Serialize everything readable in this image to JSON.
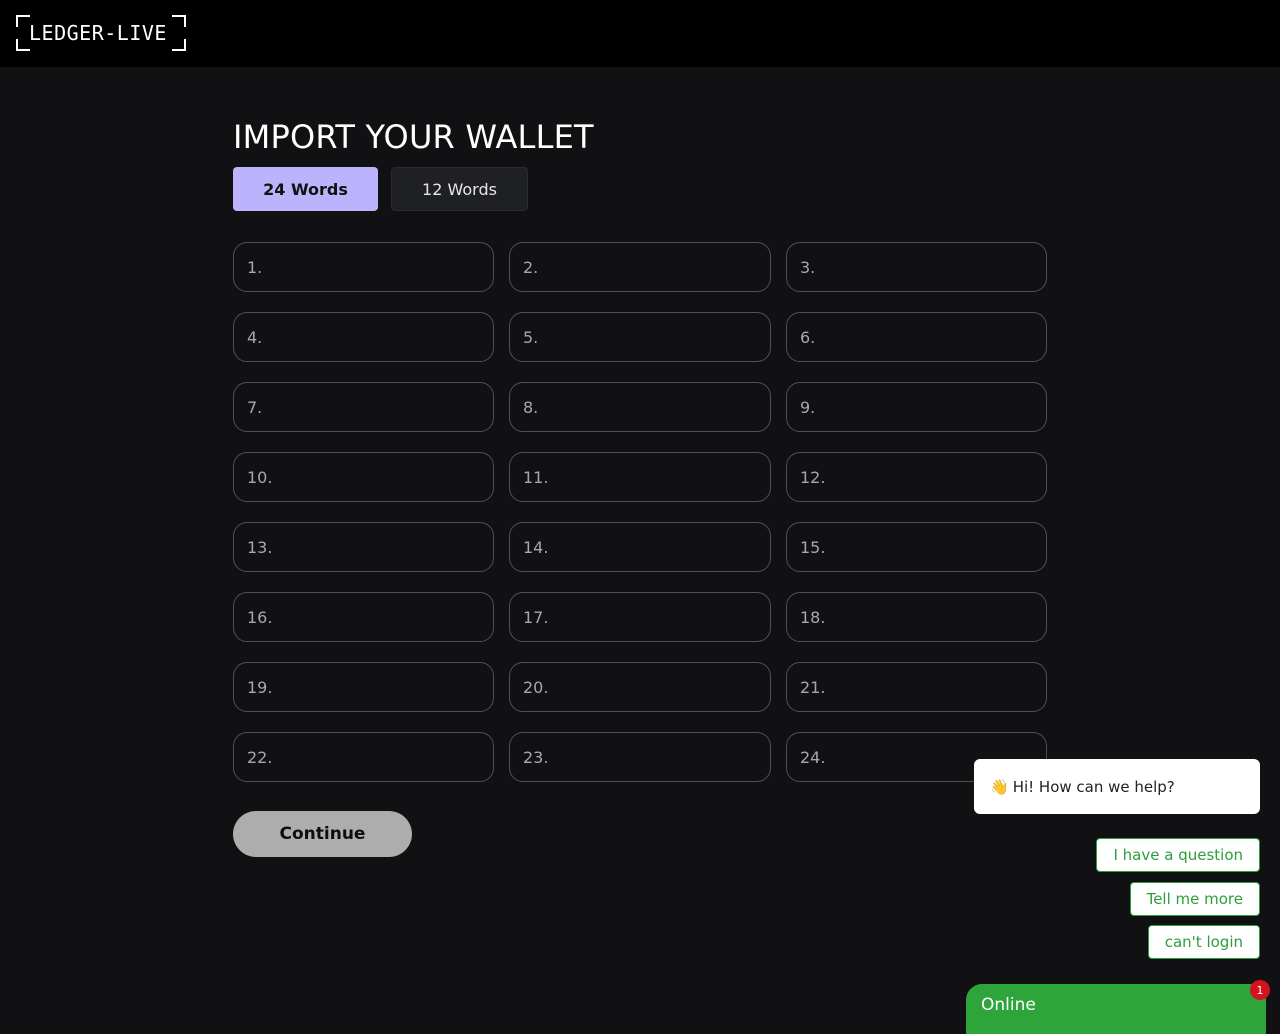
{
  "header": {
    "logo_text": "LEDGER-LIVE"
  },
  "main": {
    "title": "IMPORT YOUR WALLET",
    "tabs": [
      {
        "label": "24 Words",
        "active": true
      },
      {
        "label": "12 Words",
        "active": false
      }
    ],
    "word_fields": [
      {
        "placeholder": "1.",
        "value": ""
      },
      {
        "placeholder": "2.",
        "value": ""
      },
      {
        "placeholder": "3.",
        "value": ""
      },
      {
        "placeholder": "4.",
        "value": ""
      },
      {
        "placeholder": "5.",
        "value": ""
      },
      {
        "placeholder": "6.",
        "value": ""
      },
      {
        "placeholder": "7.",
        "value": ""
      },
      {
        "placeholder": "8.",
        "value": ""
      },
      {
        "placeholder": "9.",
        "value": ""
      },
      {
        "placeholder": "10.",
        "value": ""
      },
      {
        "placeholder": "11.",
        "value": ""
      },
      {
        "placeholder": "12.",
        "value": ""
      },
      {
        "placeholder": "13.",
        "value": ""
      },
      {
        "placeholder": "14.",
        "value": ""
      },
      {
        "placeholder": "15.",
        "value": ""
      },
      {
        "placeholder": "16.",
        "value": ""
      },
      {
        "placeholder": "17.",
        "value": ""
      },
      {
        "placeholder": "18.",
        "value": ""
      },
      {
        "placeholder": "19.",
        "value": ""
      },
      {
        "placeholder": "20.",
        "value": ""
      },
      {
        "placeholder": "21.",
        "value": ""
      },
      {
        "placeholder": "22.",
        "value": ""
      },
      {
        "placeholder": "23.",
        "value": ""
      },
      {
        "placeholder": "24.",
        "value": ""
      }
    ],
    "continue_label": "Continue"
  },
  "chat": {
    "greeting_emoji": "👋",
    "greeting": "Hi! How can we help?",
    "quick_replies": [
      "I have a question",
      "Tell me more",
      "can't login"
    ],
    "launcher_label": "Online",
    "unread_count": "1"
  },
  "colors": {
    "background": "#111113",
    "accent": "#bbb4fc",
    "chat_green": "#2ea53a",
    "badge_red": "#d2141e"
  }
}
